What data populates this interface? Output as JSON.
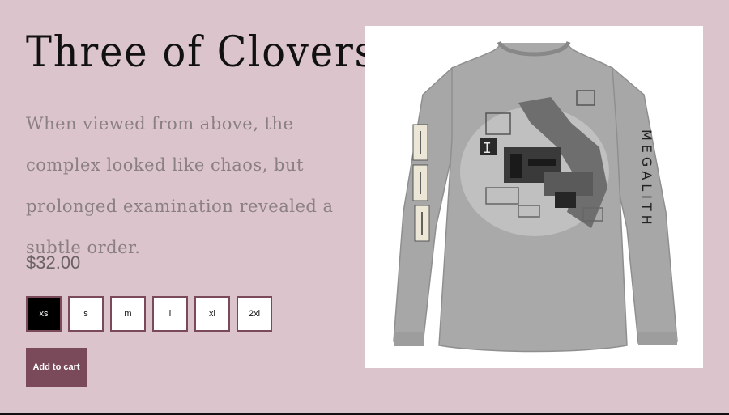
{
  "product": {
    "title": "Three of Clovers",
    "description": "When viewed from above, the complex looked like chaos, but prolonged examination revealed a subtle order.",
    "price": "$32.00",
    "sleeve_text": "MEGALITH"
  },
  "sizes": [
    {
      "label": "xs",
      "selected": true
    },
    {
      "label": "s",
      "selected": false
    },
    {
      "label": "m",
      "selected": false
    },
    {
      "label": "l",
      "selected": false
    },
    {
      "label": "xl",
      "selected": false
    },
    {
      "label": "2xl",
      "selected": false
    }
  ],
  "cart": {
    "label": "Add to cart"
  },
  "colors": {
    "background": "#dbc4cb",
    "accent": "#7a4a5a",
    "shirt": "#a9a9a9"
  }
}
